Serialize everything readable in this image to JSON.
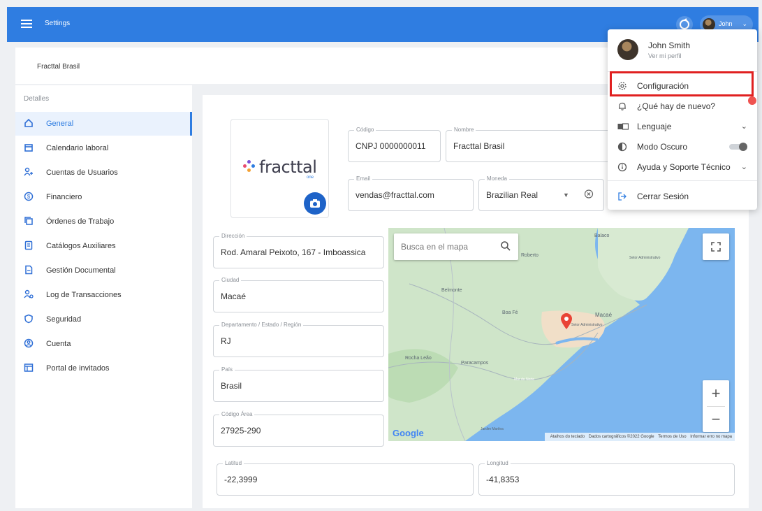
{
  "topbar": {
    "title": "Settings",
    "user": "John"
  },
  "company": {
    "name": "Fracttal Brasil"
  },
  "sidebar": {
    "header": "Detalles",
    "items": [
      {
        "label": "General",
        "icon": "home-icon",
        "active": true
      },
      {
        "label": "Calendario laboral",
        "icon": "calendar-icon"
      },
      {
        "label": "Cuentas de Usuarios",
        "icon": "add-user-icon"
      },
      {
        "label": "Financiero",
        "icon": "dollar-icon"
      },
      {
        "label": "Órdenes de Trabajo",
        "icon": "copy-icon"
      },
      {
        "label": "Catálogos Auxiliares",
        "icon": "catalog-icon"
      },
      {
        "label": "Gestión Documental",
        "icon": "document-icon"
      },
      {
        "label": "Log de Transacciones",
        "icon": "user-log-icon"
      },
      {
        "label": "Seguridad",
        "icon": "shield-icon"
      },
      {
        "label": "Cuenta",
        "icon": "account-icon"
      },
      {
        "label": "Portal de invitados",
        "icon": "portal-icon"
      }
    ]
  },
  "logo": {
    "text": "fracttal",
    "sub": "one"
  },
  "form": {
    "codigo": {
      "label": "Código",
      "value": "CNPJ 0000000011"
    },
    "nombre": {
      "label": "Nombre",
      "value": "Fracttal Brasil"
    },
    "email": {
      "label": "Email",
      "value": "vendas@fracttal.com"
    },
    "moneda": {
      "label": "Moneda",
      "value": "Brazilian Real"
    },
    "direccion": {
      "label": "Dirección",
      "value": "Rod. Amaral Peixoto, 167 - Imboassica"
    },
    "ciudad": {
      "label": "Ciudad",
      "value": "Macaé"
    },
    "departamento": {
      "label": "Departamento / Estado / Región",
      "value": "RJ"
    },
    "pais": {
      "label": "País",
      "value": "Brasil"
    },
    "codigo_area": {
      "label": "Código Área",
      "value": "27925-290"
    },
    "latitud": {
      "label": "Latitud",
      "value": "-22,3999"
    },
    "longitud": {
      "label": "Longitud",
      "value": "-41,8353"
    }
  },
  "map": {
    "search_placeholder": "Busca en el mapa",
    "places": [
      "Balaco",
      "Setor Administrativo",
      "Belmonte",
      "Boa Fé",
      "Macaé",
      "Setor Administrativo",
      "Rocha Leão",
      "Paracampos",
      "Mar do Norte",
      "Jardim Marilea",
      "Roberto"
    ],
    "footer": [
      "Atalhos do teclado",
      "Dados cartográficos ©2022 Google",
      "Termos de Uso",
      "Informar erro no mapa"
    ],
    "brand": "Google"
  },
  "dropdown": {
    "name": "John Smith",
    "profile_link": "Ver mi perfil",
    "items": [
      {
        "label": "Configuración",
        "icon": "gear-icon"
      },
      {
        "label": "¿Qué hay de nuevo?",
        "icon": "bell-icon"
      },
      {
        "label": "Lenguaje",
        "icon": "language-icon"
      },
      {
        "label": "Modo Oscuro",
        "icon": "contrast-icon"
      },
      {
        "label": "Ayuda y Soporte Técnico",
        "icon": "info-icon"
      },
      {
        "label": "Cerrar Sesión",
        "icon": "logout-icon"
      }
    ]
  }
}
